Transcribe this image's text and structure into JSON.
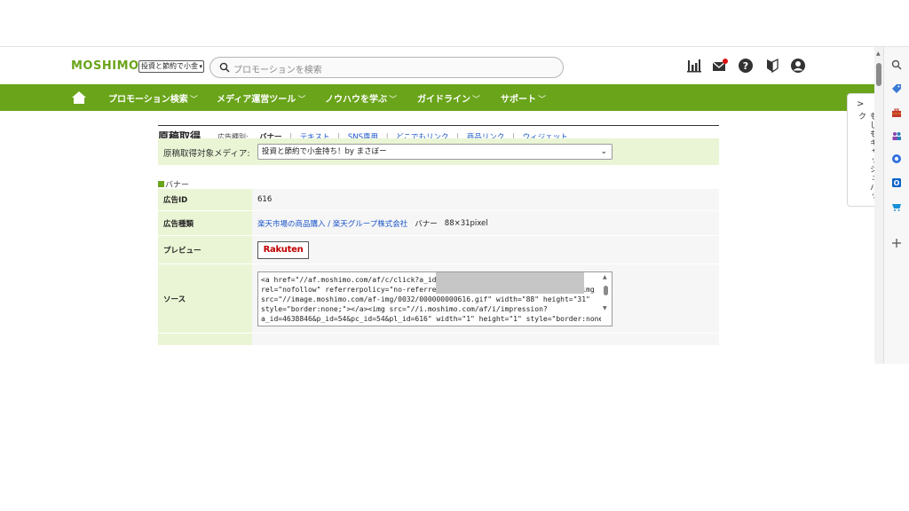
{
  "header": {
    "logo": "MOSHIMO",
    "media_select_value": "投資と節約で小金",
    "search_placeholder": "プロモーションを検索"
  },
  "nav": {
    "items": [
      "プロモーション検索",
      "メディア運営ツール",
      "ノウハウを学ぶ",
      "ガイドライン",
      "サポート"
    ]
  },
  "page": {
    "title": "原稿取得",
    "type_label": "広告種別:",
    "tabs": [
      {
        "label": "バナー",
        "active": true
      },
      {
        "label": "テキスト"
      },
      {
        "label": "SNS専用"
      },
      {
        "label": "どこでもリンク"
      },
      {
        "label": "商品リンク"
      },
      {
        "label": "ウィジェット"
      }
    ],
    "media_label": "原稿取得対象メディア:",
    "media_value": "投資と節約で小金持ち！by まさぼー",
    "section": "バナー"
  },
  "table": {
    "rows": [
      {
        "label": "広告ID",
        "value": "616"
      },
      {
        "label": "広告種類",
        "value_link": "楽天市場の商品購入 / 楽天グループ株式会社",
        "value_type": "バナー",
        "value_size": "88×31pixel"
      },
      {
        "label": "プレビュー",
        "badge": "Rakuten"
      },
      {
        "label": "ソース",
        "code": "<a href=\"//af.moshimo.com/af/c/click?a_id=4\nrel=\"nofollow\" referrerpolicy=\"no-referrer-when-downgrade\" attributionsrc><img\nsrc=\"//image.moshimo.com/af-img/0032/000000000616.gif\" width=\"88\" height=\"31\"\nstyle=\"border:none;\"></a><img src=\"//i.moshimo.com/af/i/impression?\na_id=4638846&p_id=54&pc_id=54&pl_id=616\" width=\"1\" height=\"1\" style=\"border:none;\""
      }
    ]
  },
  "sidebar": {
    "cashback_label": "もしもキャッシュバック"
  },
  "colors": {
    "brand_green": "#6aa41a",
    "light_green": "#eaf5d5",
    "link_blue": "#1a55c9",
    "rakuten_red": "#bf0000"
  }
}
